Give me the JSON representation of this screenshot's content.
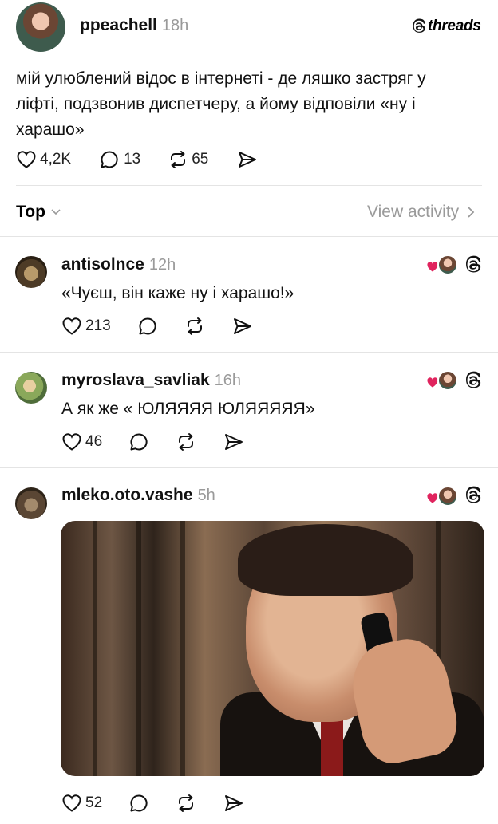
{
  "post": {
    "username": "ppeachell",
    "time": "18h",
    "brand": "threads",
    "text_line1": "мій улюблений відос в інтернеті - де ляшко застряг у",
    "text_line2": "ліфті, подзвонив диспетчеру, а йому відповіли «ну і",
    "text_line3": "харашо»",
    "likes": "4,2K",
    "replies": "13",
    "reposts": "65"
  },
  "sort": {
    "label": "Top",
    "view_activity": "View activity"
  },
  "comments": [
    {
      "username": "antisolnce",
      "time": "12h",
      "text": "«Чуєш, він каже ну і харашо!»",
      "likes": "213"
    },
    {
      "username": "myroslava_savliak",
      "time": "16h",
      "text": "А як же « ЮЛЯЯЯЯ ЮЛЯЯЯЯЯ»",
      "likes": "46"
    },
    {
      "username": "mleko.oto.vashe",
      "time": "5h",
      "text": "",
      "likes": "52"
    }
  ],
  "icons": {
    "heart": "heart-icon",
    "reply": "comment-bubble-icon",
    "repost": "repost-icon",
    "share": "send-icon",
    "threads": "threads-logo-icon",
    "chevron_down": "chevron-down-icon",
    "chevron_right": "chevron-right-icon"
  },
  "colors": {
    "text": "#111111",
    "muted": "#9a9a9a",
    "divider": "#e4e4e4",
    "heart_red": "#e0245e"
  }
}
